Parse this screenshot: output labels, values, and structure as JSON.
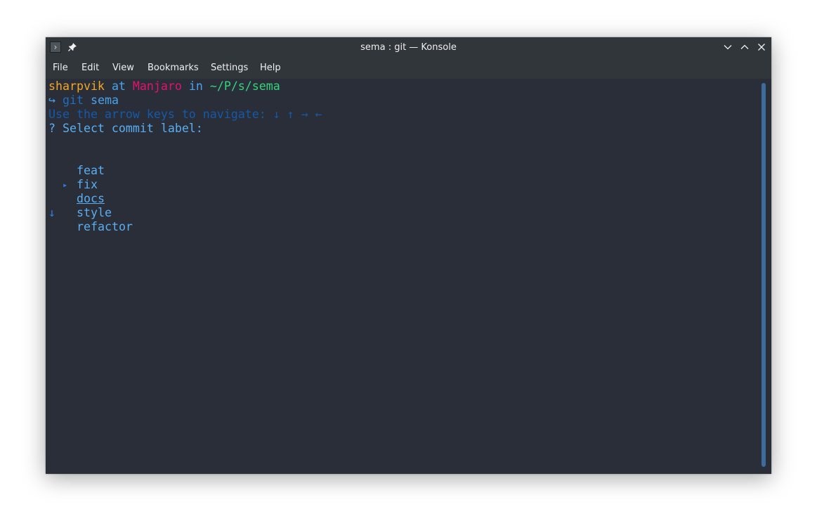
{
  "window": {
    "title": "sema : git — Konsole",
    "app_icon_glyph": "›"
  },
  "menu": [
    {
      "label": "File"
    },
    {
      "label": "Edit"
    },
    {
      "label": "View"
    },
    {
      "label": "Bookmarks"
    },
    {
      "label": "Settings"
    },
    {
      "label": "Help"
    }
  ],
  "terminal": {
    "prompt": {
      "user": "sharpvik",
      "at": "at",
      "host": "Manjaro",
      "in": "in",
      "path": "~/P/s/sema"
    },
    "command": {
      "arrow": "↪",
      "cmd": "git",
      "arg": "sema"
    },
    "hint": "Use the arrow keys to navigate: ↓ ↑ → ←",
    "question": "? Select commit label:",
    "options": [
      {
        "label": "feat",
        "marker": ""
      },
      {
        "label": "fix",
        "marker": ""
      },
      {
        "label": "docs",
        "marker": "▸"
      },
      {
        "label": "style",
        "marker": ""
      },
      {
        "label": "refactor",
        "marker": "↓"
      }
    ],
    "selected_index": 2
  },
  "colors": {
    "terminal_bg": "#2a2e39",
    "titlebar_bg": "#31363b",
    "user": "#f5a623",
    "host": "#e3126f",
    "path": "#32d67a",
    "keyword": "#4aa3e8"
  }
}
